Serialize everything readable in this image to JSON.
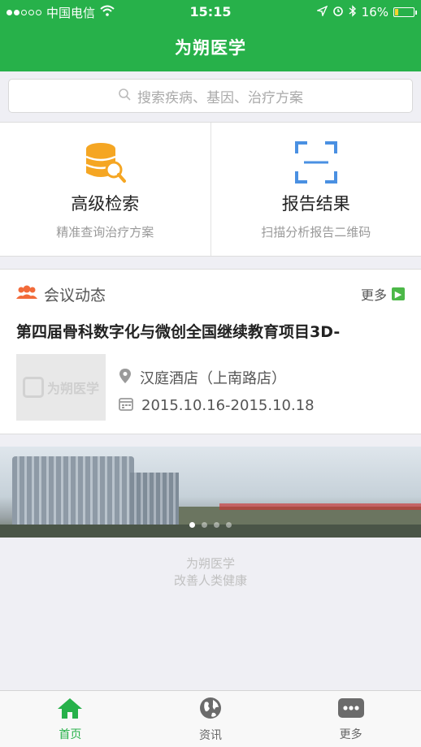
{
  "status_bar": {
    "carrier": "中国电信",
    "time": "15:15",
    "battery": "16%",
    "battery_level": 0.16
  },
  "nav": {
    "title": "为朔医学"
  },
  "search": {
    "placeholder": "搜索疾病、基因、治疗方案"
  },
  "features": [
    {
      "title": "高级检索",
      "subtitle": "精准查询治疗方案",
      "icon": "database-search-icon"
    },
    {
      "title": "报告结果",
      "subtitle": "扫描分析报告二维码",
      "icon": "qr-scan-icon"
    }
  ],
  "meeting": {
    "section_title": "会议动态",
    "more_label": "更多",
    "item_title": "第四届骨科数字化与微创全国继续教育项目3D-",
    "thumbnail_text": "为朔医学",
    "location": "汉庭酒店（上南路店）",
    "dates": "2015.10.16-2015.10.18"
  },
  "banner": {
    "slide_count": 4,
    "active_index": 0
  },
  "footer": {
    "line1": "为朔医学",
    "line2": "改善人类健康"
  },
  "tabs": [
    {
      "label": "首页",
      "icon": "home-icon",
      "active": true
    },
    {
      "label": "资讯",
      "icon": "globe-icon",
      "active": false
    },
    {
      "label": "更多",
      "icon": "more-icon",
      "active": false
    }
  ],
  "colors": {
    "brand_green": "#27b14a",
    "accent_orange": "#f5a623",
    "accent_blue": "#4a90e2"
  }
}
